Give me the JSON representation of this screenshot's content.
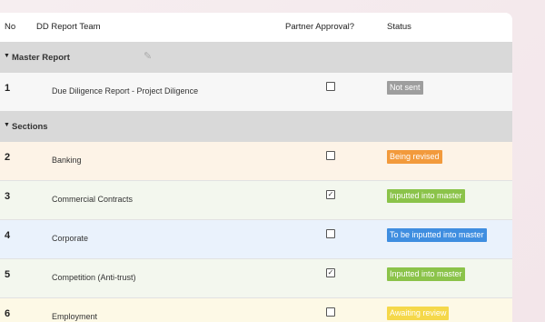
{
  "header": {
    "no": "No",
    "team": "DD Report Team",
    "approval": "Partner Approval?",
    "status": "Status"
  },
  "groups": {
    "master": {
      "label": "Master Report"
    },
    "sections": {
      "label": "Sections"
    }
  },
  "rows": [
    {
      "no": "1",
      "name": "Due Diligence Report - Project Diligence",
      "checked": false,
      "status": "Not sent",
      "status_color": "#9e9e9e",
      "row_bg": "#f7f7f7"
    },
    {
      "no": "2",
      "name": "Banking",
      "checked": false,
      "status": "Being revised",
      "status_color": "#f29a3c",
      "row_bg": "#fdf3e7"
    },
    {
      "no": "3",
      "name": "Commercial Contracts",
      "checked": true,
      "status": "Inputted into master",
      "status_color": "#8bc34a",
      "row_bg": "#f3f7ee"
    },
    {
      "no": "4",
      "name": "Corporate",
      "checked": false,
      "status": "To be inputted into master",
      "status_color": "#3f8ee0",
      "row_bg": "#eaf2fc"
    },
    {
      "no": "5",
      "name": "Competition (Anti-trust)",
      "checked": true,
      "status": "Inputted into master",
      "status_color": "#8bc34a",
      "row_bg": "#f3f7ee"
    },
    {
      "no": "6",
      "name": "Employment",
      "checked": false,
      "status": "Awaiting review",
      "status_color": "#f5d84a",
      "row_bg": "#fdf9e6"
    }
  ]
}
